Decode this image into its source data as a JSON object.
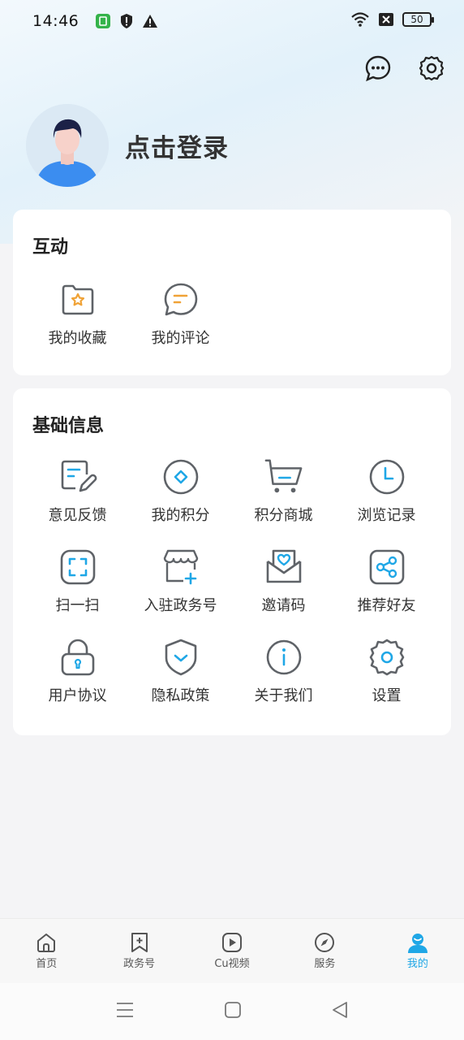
{
  "status": {
    "time": "14:46",
    "battery": "50"
  },
  "profile": {
    "login_label": "点击登录"
  },
  "interaction": {
    "title": "互动",
    "items": [
      {
        "label": "我的收藏",
        "icon": "favorites-folder-icon"
      },
      {
        "label": "我的评论",
        "icon": "comment-icon"
      }
    ]
  },
  "basic": {
    "title": "基础信息",
    "items": [
      {
        "label": "意见反馈",
        "icon": "feedback-icon"
      },
      {
        "label": "我的积分",
        "icon": "points-icon"
      },
      {
        "label": "积分商城",
        "icon": "shopping-cart-icon"
      },
      {
        "label": "浏览记录",
        "icon": "clock-icon"
      },
      {
        "label": "扫一扫",
        "icon": "scan-icon"
      },
      {
        "label": "入驻政务号",
        "icon": "store-add-icon"
      },
      {
        "label": "邀请码",
        "icon": "invite-envelope-icon"
      },
      {
        "label": "推荐好友",
        "icon": "share-icon"
      },
      {
        "label": "用户协议",
        "icon": "lock-icon"
      },
      {
        "label": "隐私政策",
        "icon": "shield-check-icon"
      },
      {
        "label": "关于我们",
        "icon": "info-icon"
      },
      {
        "label": "设置",
        "icon": "gear-icon"
      }
    ]
  },
  "tabs": [
    {
      "label": "首页",
      "icon": "home-icon"
    },
    {
      "label": "政务号",
      "icon": "bookmark-plus-icon"
    },
    {
      "label": "Cu视频",
      "icon": "video-play-icon"
    },
    {
      "label": "服务",
      "icon": "compass-icon"
    },
    {
      "label": "我的",
      "icon": "user-icon",
      "active": true
    }
  ],
  "colors": {
    "accent": "#1fa7e6",
    "icon_gray": "#5f6368",
    "icon_orange": "#f0a236",
    "avatar_shirt": "#3b8df0"
  }
}
